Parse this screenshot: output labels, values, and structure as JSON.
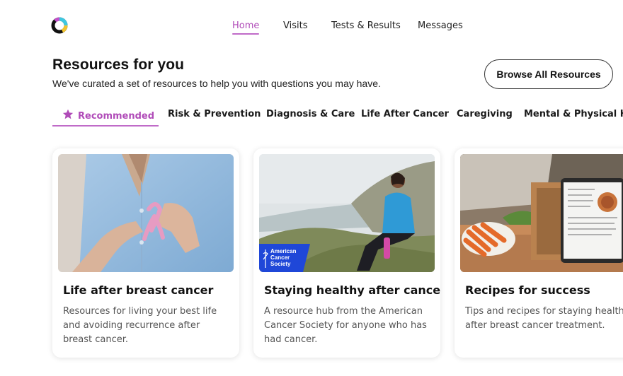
{
  "brand": {
    "logo_icon": "ring-logo-icon",
    "accent_color": "#b04bb8"
  },
  "topnav": {
    "items": [
      {
        "label": "Home",
        "active": true
      },
      {
        "label": "Visits",
        "active": false
      },
      {
        "label": "Tests & Results",
        "active": false
      },
      {
        "label": "Messages",
        "active": false
      }
    ]
  },
  "header": {
    "title": "Resources for you",
    "subtitle": "We've curated a set of resources to help you with questions you may have.",
    "browse_button": "Browse All Resources"
  },
  "tabs": {
    "items": [
      {
        "label": "Recommended",
        "icon": "star-icon",
        "active": true
      },
      {
        "label": "Risk & Prevention",
        "active": false
      },
      {
        "label": "Diagnosis & Care",
        "active": false
      },
      {
        "label": "Life After Cancer",
        "active": false
      },
      {
        "label": "Caregiving",
        "active": false
      },
      {
        "label": "Mental & Physical Hea",
        "active": false
      }
    ]
  },
  "cards": [
    {
      "title": "Life after breast cancer",
      "description": "Resources for living your best life and avoiding recurrence after breast cancer.",
      "image": "pink-ribbon-photo"
    },
    {
      "title": "Staying healthy after cancer",
      "description": "A resource hub from the American Cancer Society for anyone who has had cancer.",
      "image": "woman-on-hillside-photo",
      "badge": {
        "line1": "American",
        "line2": "Cancer",
        "line3": "Society"
      }
    },
    {
      "title": "Recipes for success",
      "description": "Tips and recipes for staying health after breast cancer treatment.",
      "image": "kitchen-tablet-recipe-photo"
    }
  ]
}
